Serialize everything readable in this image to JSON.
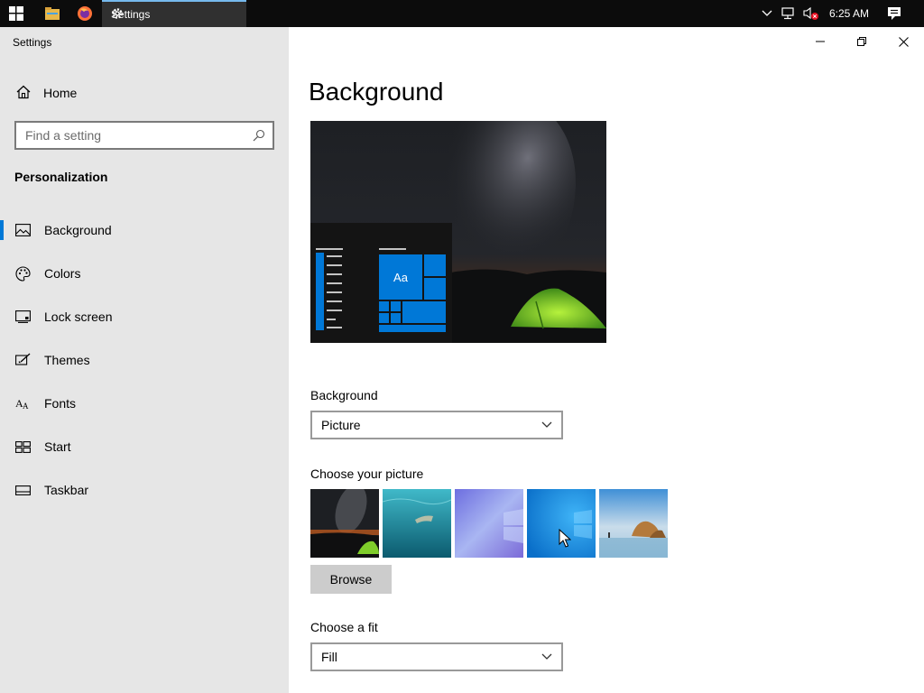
{
  "taskbar": {
    "active_app_label": "Settings",
    "clock": "6:25 AM",
    "icons": [
      "windows-start-icon",
      "file-explorer-icon",
      "firefox-icon",
      "gear-icon",
      "chevron-up-icon",
      "network-icon",
      "volume-muted-icon",
      "action-center-icon"
    ]
  },
  "window": {
    "title": "Settings",
    "controls": [
      "minimize",
      "maximize",
      "close"
    ]
  },
  "sidebar": {
    "home_label": "Home",
    "search_placeholder": "Find a setting",
    "section_title": "Personalization",
    "items": [
      {
        "label": "Background",
        "icon": "image-icon",
        "active": true
      },
      {
        "label": "Colors",
        "icon": "palette-icon",
        "active": false
      },
      {
        "label": "Lock screen",
        "icon": "lock-screen-icon",
        "active": false
      },
      {
        "label": "Themes",
        "icon": "brush-icon",
        "active": false
      },
      {
        "label": "Fonts",
        "icon": "font-icon",
        "active": false
      },
      {
        "label": "Start",
        "icon": "start-icon",
        "active": false
      },
      {
        "label": "Taskbar",
        "icon": "taskbar-icon",
        "active": false
      }
    ]
  },
  "main": {
    "page_title": "Background",
    "preview_tile_text": "Aa",
    "background_label": "Background",
    "background_value": "Picture",
    "choose_picture_label": "Choose your picture",
    "pictures": [
      "night-sky-tent",
      "underwater-swimmer",
      "windows-light-purple",
      "windows-blue",
      "beach-rocks"
    ],
    "browse_label": "Browse",
    "fit_label": "Choose a fit",
    "fit_value": "Fill"
  },
  "colors": {
    "accent": "#0078d7",
    "sidebar_bg": "#e6e6e6",
    "taskbar_bg": "#0c0c0c"
  }
}
